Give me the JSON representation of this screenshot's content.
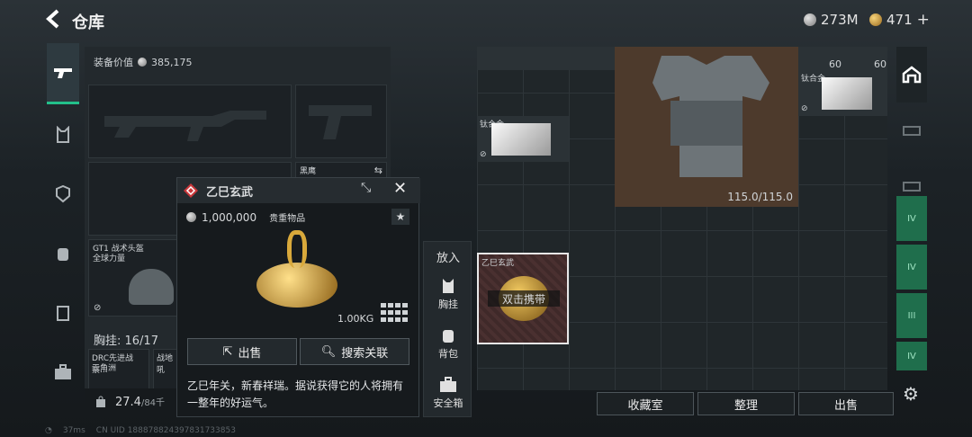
{
  "header": {
    "title": "仓库",
    "silver": "273M",
    "gold": "471",
    "plus": "+"
  },
  "loadout": {
    "equip_value_label": "装备价值",
    "equip_value": "385,175",
    "pistol_slot_label": "黑鹰",
    "helmet_name": "GT1 战术头盔",
    "helmet_sub": "全球力量",
    "chest_label": "胸挂: 16/17",
    "item_a": "DRC先进战察...",
    "item_a_sub": "三角洲",
    "item_b": "战地吼",
    "weight": "27.4",
    "weight_max": "/84千"
  },
  "popup": {
    "name": "乙巳玄武",
    "price": "1,000,000",
    "tag": "贵重物品",
    "weight": "1.00KG",
    "sell": "出售",
    "search": "搜索关联",
    "desc": "乙巳年关，新春祥瑞。据说获得它的人将拥有一整年的好运气。"
  },
  "side": {
    "put": "放入",
    "chest": "胸挂",
    "backpack": "背包",
    "safe": "安全箱"
  },
  "grid": {
    "titanium1": "钛合金",
    "titanium2": "钛合金",
    "count1": "60",
    "count2": "60",
    "armor_durability": "115.0/115.0",
    "selected_name": "乙巳玄武",
    "hint": "双击携带"
  },
  "bottom": {
    "collection": "收藏室",
    "organize": "整理",
    "sell": "出售"
  },
  "status": {
    "ping": "37ms",
    "uid": "CN UID 188878824397831733853"
  },
  "colors": {
    "accent_green": "#23c08a",
    "gold": "#c99a2e",
    "danger": "#c9373a"
  }
}
